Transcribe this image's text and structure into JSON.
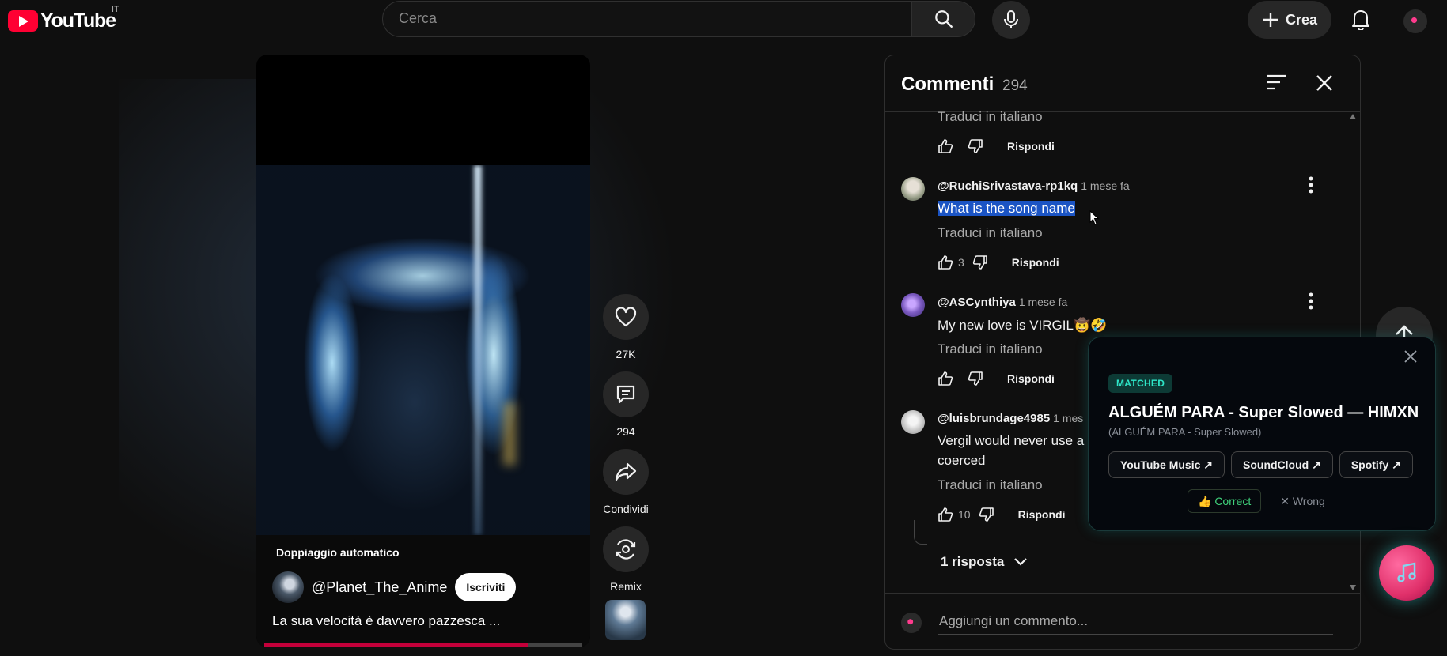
{
  "header": {
    "logo_text": "YouTube",
    "region": "IT",
    "search_placeholder": "Cerca",
    "create_label": "Crea"
  },
  "video": {
    "dubbing_label": "Doppiaggio automatico",
    "channel_name": "@Planet_The_Anime",
    "subscribe_label": "Iscriviti",
    "caption": "La sua velocità è davvero pazzesca ...",
    "progress_fraction": 0.83
  },
  "actions": {
    "likes": "27K",
    "comments": "294",
    "share": "Condividi",
    "remix": "Remix"
  },
  "comments_panel": {
    "title": "Commenti",
    "count": "294",
    "translate_label": "Traduci in italiano",
    "reply_label": "Rispondi",
    "replies_label": "1 risposta",
    "add_placeholder": "Aggiungi un commento...",
    "comments": [
      {
        "user": "",
        "time": "",
        "text": "",
        "likes": ""
      },
      {
        "user": "@RuchiSrivastava-rp1kq",
        "time": "1 mese fa",
        "text": "What is the song name",
        "likes": "3"
      },
      {
        "user": "@ASCynthiya",
        "time": "1 mese fa",
        "text": "My new love is VIRGIL🤠🤣",
        "likes": ""
      },
      {
        "user": "@luisbrundage4985",
        "time": "1 mes",
        "text": "Vergil would never use a",
        "text2": "coerced",
        "likes": "10"
      }
    ]
  },
  "popup": {
    "badge": "MATCHED",
    "song": "ALGUÉM PARA - Super Slowed — HIMXN",
    "song_sub": "(ALGUÉM PARA - Super Slowed)",
    "links": [
      "YouTube Music ↗",
      "SoundCloud ↗",
      "Spotify ↗"
    ],
    "correct_label": "👍 Correct",
    "wrong_label": "✕ Wrong"
  },
  "colors": {
    "brand": "#ff0033",
    "accent_teal": "#2ee6c8",
    "highlight": "#1b54c4",
    "progress": "#c4003a"
  }
}
